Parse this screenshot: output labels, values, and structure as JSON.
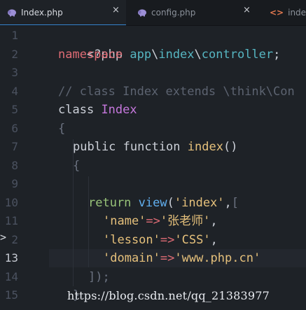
{
  "tabs": [
    {
      "label": "Index.php",
      "icon": "php-elephant-icon",
      "active": true
    },
    {
      "label": "config.php",
      "icon": "php-elephant-icon",
      "active": false
    },
    {
      "label": "index.h",
      "icon": "html-code-icon",
      "active": false
    }
  ],
  "close_glyph": "×",
  "html_icon_glyph": "<>",
  "line_numbers": [
    "1",
    "2",
    "3",
    "4",
    "5",
    "6",
    "7",
    "8",
    "9",
    "10",
    "11",
    "2",
    "13",
    "14",
    "15"
  ],
  "fold_marker": ">",
  "code": {
    "l1": "<?php",
    "l2_kw": "namespace",
    "l2_ns1": "app",
    "l2_sep1": "\\",
    "l2_ns2": "index",
    "l2_sep2": "\\",
    "l2_ns3": "controller",
    "l2_end": ";",
    "l4": "// class Index extends \\think\\Con",
    "l5_kw": "class",
    "l5_name": "Index",
    "l6": "{",
    "l7_kw": "public function",
    "l7_name": "index",
    "l7_parens": "()",
    "l8": "{",
    "l10_kw": "return",
    "l10_call": "view",
    "l10_open": "(",
    "l10_str": "'index'",
    "l10_comma": ",",
    "l10_bracket": "[",
    "l11_key": "'name'",
    "l11_arrow": "=>",
    "l11_val": "'张老师'",
    "l11_comma": ",",
    "l12_key": "'lesson'",
    "l12_arrow": "=>",
    "l12_val": "'CSS'",
    "l12_comma": ",",
    "l13_key": "'domain'",
    "l13_arrow": "=>",
    "l13_val": "'www.php.cn'",
    "l14": "]);",
    "l15": "}"
  },
  "watermark": "https://blog.csdn.net/qq_21383977",
  "colors": {
    "background": "#1e2227",
    "tab_bar": "#181b1f",
    "active_tab_underline": "#3a8bd8",
    "keyword_red": "#e06c75",
    "namespace_cyan": "#56b6c2",
    "class_purple": "#c678dd",
    "function_yellow": "#e5c07b",
    "return_green": "#98c379",
    "call_blue": "#61afef",
    "comment_gray": "#5c6370"
  }
}
